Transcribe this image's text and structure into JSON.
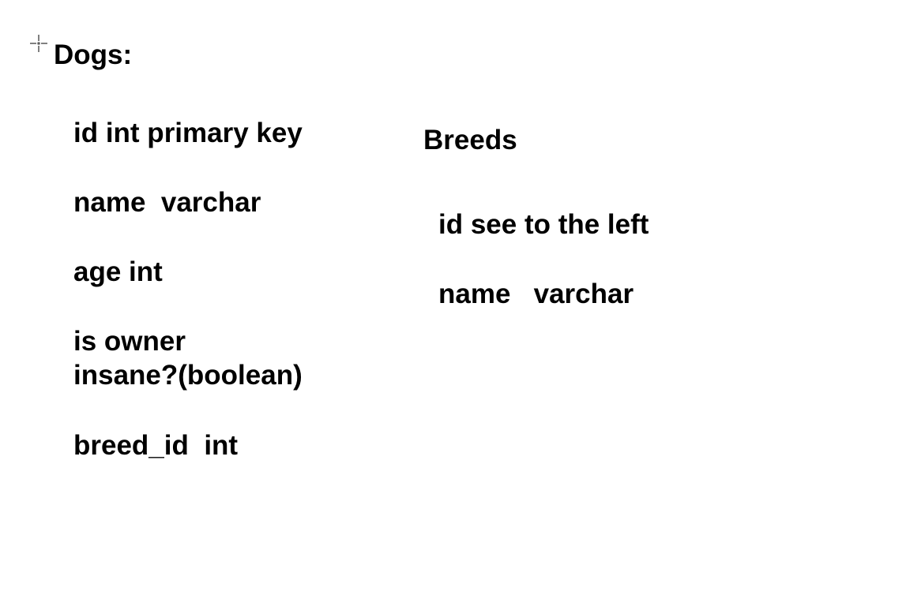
{
  "dogs": {
    "title": "Dogs:",
    "fields": [
      "id int primary key",
      "name  varchar",
      "age int",
      "is owner",
      "insane?(boolean)",
      "breed_id  int"
    ]
  },
  "breeds": {
    "title": "Breeds",
    "fields": [
      "id see to the left",
      "name   varchar"
    ]
  },
  "icons": {
    "cursor": "crosshair-cursor-icon"
  },
  "colors": {
    "text": "#000000",
    "background": "#ffffff"
  }
}
